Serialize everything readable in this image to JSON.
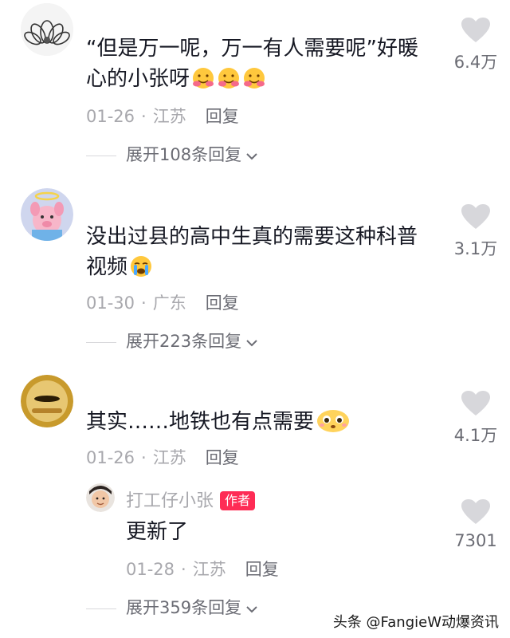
{
  "comments": [
    {
      "avatar": "lotus-flower-avatar",
      "text": "“但是万一呢，万一有人需要呢”好暖心的小张呀",
      "emoji": [
        "hug-emoji",
        "hug-emoji",
        "hug-emoji"
      ],
      "date": "01-26",
      "location": "江苏",
      "reply_label": "回复",
      "likes": "6.4万",
      "expand_label": "展开108条回复"
    },
    {
      "avatar": "piglet-angel-avatar",
      "text": "没出过县的高中生真的需要这种科普视频",
      "emoji": [
        "crying-emoji"
      ],
      "date": "01-30",
      "location": "广东",
      "reply_label": "回复",
      "likes": "3.1万",
      "expand_label": "展开223条回复"
    },
    {
      "avatar": "cat-face-avatar",
      "text": "其实……地铁也有点需要",
      "emoji": [
        "pleading-emoji"
      ],
      "date": "01-26",
      "location": "江苏",
      "reply_label": "回复",
      "likes": "4.1万",
      "reply": {
        "avatar": "boy-face-avatar",
        "author": "打工仔小张",
        "author_badge": "作者",
        "text": "更新了",
        "date": "01-28",
        "location": "江苏",
        "reply_label": "回复",
        "likes": "7301"
      },
      "expand_label": "展开359条回复"
    }
  ],
  "watermark": "头条 @FangieW动爆资讯",
  "colors": {
    "text": "#161823",
    "meta": "#a8a8ad",
    "secondary": "#6b6c74",
    "heart": "#d7d7db",
    "badge": "#fe2c55"
  }
}
